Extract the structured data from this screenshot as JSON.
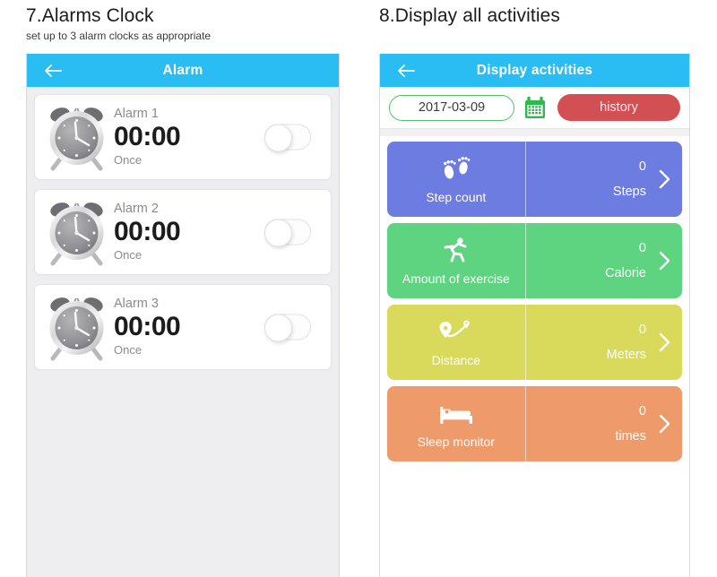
{
  "sections": [
    {
      "title": "7.Alarms Clock",
      "subtitle": "set up to 3 alarm clocks as appropriate"
    },
    {
      "title": "8.Display all activities",
      "subtitle": ""
    }
  ],
  "alarm_screen": {
    "appbar": {
      "back_icon": "arrow-left-icon",
      "title": "Alarm",
      "bg": "#29bdf3"
    },
    "alarms": [
      {
        "name": "Alarm 1",
        "time": "00:00",
        "repeat": "Once",
        "enabled": false,
        "icon": "alarm-clock-icon"
      },
      {
        "name": "Alarm 2",
        "time": "00:00",
        "repeat": "Once",
        "enabled": false,
        "icon": "alarm-clock-icon"
      },
      {
        "name": "Alarm 3",
        "time": "00:00",
        "repeat": "Once",
        "enabled": false,
        "icon": "alarm-clock-icon"
      }
    ]
  },
  "activities_screen": {
    "appbar": {
      "back_icon": "arrow-left-icon",
      "title": "Display activities",
      "bg": "#29bdf3"
    },
    "toolbar": {
      "date_value": "2017-03-09",
      "date_border_color": "#53c36a",
      "calendar_icon": "calendar-icon",
      "calendar_icon_color": "#2eb84f",
      "history_label": "history",
      "history_color": "#d24f54"
    },
    "cards": [
      {
        "label": "Step count",
        "value": "0",
        "unit": "Steps",
        "color": "#6d7ce0",
        "icon": "footprints-icon",
        "chevron": "chevron-right-icon"
      },
      {
        "label": "Amount of exercise",
        "value": "0",
        "unit": "Calorie",
        "color": "#5ed481",
        "icon": "runner-icon",
        "chevron": "chevron-right-icon"
      },
      {
        "label": "Distance",
        "value": "0",
        "unit": "Meters",
        "color": "#d9d95c",
        "icon": "route-pins-icon",
        "chevron": "chevron-right-icon"
      },
      {
        "label": "Sleep monitor",
        "value": "0",
        "unit": "times",
        "color": "#ef9a6b",
        "icon": "bed-icon",
        "chevron": "chevron-right-icon"
      }
    ]
  }
}
